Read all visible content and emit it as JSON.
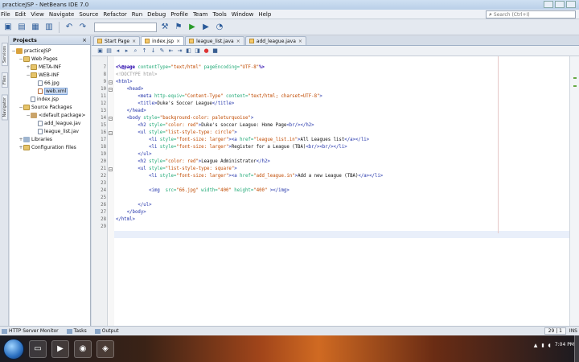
{
  "window": {
    "title": "practiceJSP - NetBeans IDE 7.0"
  },
  "menu": [
    "File",
    "Edit",
    "View",
    "Navigate",
    "Source",
    "Refactor",
    "Run",
    "Debug",
    "Profile",
    "Team",
    "Tools",
    "Window",
    "Help"
  ],
  "search": {
    "placeholder": "Search (Ctrl+I)"
  },
  "side_strip": {
    "services": "Services",
    "files": "Files",
    "navigator": "Navigator"
  },
  "projects": {
    "title": "Projects",
    "close": "×",
    "tree": [
      {
        "label": "practiceJSP",
        "depth": 0,
        "toggle": "−",
        "icon": "project-icon"
      },
      {
        "label": "Web Pages",
        "depth": 1,
        "toggle": "−",
        "icon": "folder-icon"
      },
      {
        "label": "META-INF",
        "depth": 2,
        "toggle": "+",
        "icon": "folder-icon"
      },
      {
        "label": "WEB-INF",
        "depth": 2,
        "toggle": "−",
        "icon": "folder-icon"
      },
      {
        "label": "66.jpg",
        "depth": 3,
        "toggle": "",
        "icon": "file-icon"
      },
      {
        "label": "web.xml",
        "depth": 3,
        "toggle": "",
        "icon": "xml-icon",
        "selected": true
      },
      {
        "label": "index.jsp",
        "depth": 2,
        "toggle": "",
        "icon": "file-icon"
      },
      {
        "label": "Source Packages",
        "depth": 1,
        "toggle": "−",
        "icon": "folder-icon"
      },
      {
        "label": "<default package>",
        "depth": 2,
        "toggle": "−",
        "icon": "package-icon"
      },
      {
        "label": "add_league.jav",
        "depth": 3,
        "toggle": "",
        "icon": "file-icon"
      },
      {
        "label": "league_list.jav",
        "depth": 3,
        "toggle": "",
        "icon": "file-icon"
      },
      {
        "label": "Libraries",
        "depth": 1,
        "toggle": "+",
        "icon": "library-icon"
      },
      {
        "label": "Configuration Files",
        "depth": 1,
        "toggle": "+",
        "icon": "folder-icon"
      }
    ]
  },
  "tabs": [
    {
      "label": "Start Page",
      "active": false
    },
    {
      "label": "index.jsp",
      "active": true
    },
    {
      "label": "league_list.java",
      "active": false
    },
    {
      "label": "add_league.java",
      "active": false
    }
  ],
  "editor": {
    "lines": [
      {
        "n": "7",
        "fold": "",
        "parts": [
          [
            "c-dir",
            "<%@page"
          ],
          [
            "c-attr",
            " contentType="
          ],
          [
            "c-str",
            "\"text/html\""
          ],
          [
            "c-attr",
            " pageEncoding="
          ],
          [
            "c-str",
            "\"UTF-8\""
          ],
          [
            "c-dir",
            "%>"
          ]
        ]
      },
      {
        "n": "8",
        "fold": "",
        "parts": [
          [
            "c-cmt",
            "<!DOCTYPE html>"
          ]
        ]
      },
      {
        "n": "9",
        "fold": "−",
        "parts": [
          [
            "c-tag",
            "<html>"
          ]
        ]
      },
      {
        "n": "10",
        "fold": "−",
        "parts": [
          [
            "c-tag",
            "    <head>"
          ]
        ]
      },
      {
        "n": "11",
        "fold": "",
        "parts": [
          [
            "c-tag",
            "        <meta"
          ],
          [
            "c-attr",
            " http-equiv="
          ],
          [
            "c-str",
            "\"Content-Type\""
          ],
          [
            "c-attr",
            " content="
          ],
          [
            "c-str",
            "\"text/html; charset=UTF-8\""
          ],
          [
            "c-tag",
            ">"
          ]
        ]
      },
      {
        "n": "12",
        "fold": "",
        "parts": [
          [
            "c-tag",
            "        <title>"
          ],
          [
            "c-txt",
            "Duke's Soccer League"
          ],
          [
            "c-tag",
            "</title>"
          ]
        ]
      },
      {
        "n": "13",
        "fold": "",
        "parts": [
          [
            "c-tag",
            "    </head>"
          ]
        ]
      },
      {
        "n": "14",
        "fold": "−",
        "parts": [
          [
            "c-tag",
            "    <body"
          ],
          [
            "c-attr",
            " style="
          ],
          [
            "c-str",
            "\"background-color: paleturquoise\""
          ],
          [
            "c-tag",
            ">"
          ]
        ]
      },
      {
        "n": "15",
        "fold": "",
        "parts": [
          [
            "c-tag",
            "        <h2"
          ],
          [
            "c-attr",
            " style="
          ],
          [
            "c-str",
            "\"color: red\""
          ],
          [
            "c-tag",
            ">"
          ],
          [
            "c-txt",
            "Duke's soccer League: Home Page"
          ],
          [
            "c-tag",
            "<br/></h2>"
          ]
        ]
      },
      {
        "n": "16",
        "fold": "−",
        "parts": [
          [
            "c-tag",
            "        <ul"
          ],
          [
            "c-attr",
            " style="
          ],
          [
            "c-str",
            "\"list-style-type: circle\""
          ],
          [
            "c-tag",
            ">"
          ]
        ]
      },
      {
        "n": "17",
        "fold": "",
        "parts": [
          [
            "c-tag",
            "            <li"
          ],
          [
            "c-attr",
            " style="
          ],
          [
            "c-str",
            "\"font-size: larger\""
          ],
          [
            "c-tag",
            "><a"
          ],
          [
            "c-attr",
            " href="
          ],
          [
            "c-str",
            "\"league_list.in\""
          ],
          [
            "c-tag",
            ">"
          ],
          [
            "c-txt",
            "All Leagues list"
          ],
          [
            "c-tag",
            "</a></li>"
          ]
        ]
      },
      {
        "n": "18",
        "fold": "",
        "parts": [
          [
            "c-tag",
            "            <li"
          ],
          [
            "c-attr",
            " style="
          ],
          [
            "c-str",
            "\"font-size: larger\""
          ],
          [
            "c-tag",
            ">"
          ],
          [
            "c-txt",
            "Register for a League (TBA)"
          ],
          [
            "c-tag",
            "<br/><br/></li>"
          ]
        ]
      },
      {
        "n": "19",
        "fold": "",
        "parts": [
          [
            "c-tag",
            "        </ul>"
          ]
        ]
      },
      {
        "n": "20",
        "fold": "",
        "parts": [
          [
            "c-tag",
            "        <h2"
          ],
          [
            "c-attr",
            " style="
          ],
          [
            "c-str",
            "\"color: red\""
          ],
          [
            "c-tag",
            ">"
          ],
          [
            "c-txt",
            "League Administrator"
          ],
          [
            "c-tag",
            "</h2>"
          ]
        ]
      },
      {
        "n": "21",
        "fold": "−",
        "parts": [
          [
            "c-tag",
            "        <ul"
          ],
          [
            "c-attr",
            " style="
          ],
          [
            "c-str",
            "\"list-style-type: square\""
          ],
          [
            "c-tag",
            ">"
          ]
        ]
      },
      {
        "n": "22",
        "fold": "",
        "parts": [
          [
            "c-tag",
            "            <li"
          ],
          [
            "c-attr",
            " style="
          ],
          [
            "c-str",
            "\"font-size: larger\""
          ],
          [
            "c-tag",
            "><a"
          ],
          [
            "c-attr",
            " href="
          ],
          [
            "c-str",
            "\"add_league.in\""
          ],
          [
            "c-tag",
            ">"
          ],
          [
            "c-txt",
            "Add a new League (TBA)"
          ],
          [
            "c-tag",
            "</a></li>"
          ]
        ]
      },
      {
        "n": "23",
        "fold": "",
        "parts": [
          [
            "c-txt",
            ""
          ]
        ]
      },
      {
        "n": "24",
        "fold": "",
        "parts": [
          [
            "c-tag",
            "            <img"
          ],
          [
            "c-attr",
            "  src="
          ],
          [
            "c-str",
            "\"66.jpg\""
          ],
          [
            "c-attr",
            " width="
          ],
          [
            "c-str",
            "\"400\""
          ],
          [
            "c-attr",
            " height="
          ],
          [
            "c-str",
            "\"400\""
          ],
          [
            "c-tag",
            " ></img>"
          ]
        ]
      },
      {
        "n": "25",
        "fold": "",
        "parts": [
          [
            "c-txt",
            ""
          ]
        ]
      },
      {
        "n": "26",
        "fold": "",
        "parts": [
          [
            "c-tag",
            "        </ul>"
          ]
        ]
      },
      {
        "n": "27",
        "fold": "",
        "parts": [
          [
            "c-tag",
            "    </body>"
          ]
        ]
      },
      {
        "n": "28",
        "fold": "",
        "parts": [
          [
            "c-tag",
            "</html>"
          ]
        ]
      },
      {
        "n": "29",
        "fold": "",
        "parts": [
          [
            "c-txt",
            ""
          ]
        ]
      }
    ]
  },
  "bottom": {
    "http_monitor": "HTTP Server Monitor",
    "tasks": "Tasks",
    "output": "Output",
    "position": "29 | 1",
    "mode": "INS"
  },
  "taskbar": {
    "time": "7:04 PM"
  }
}
